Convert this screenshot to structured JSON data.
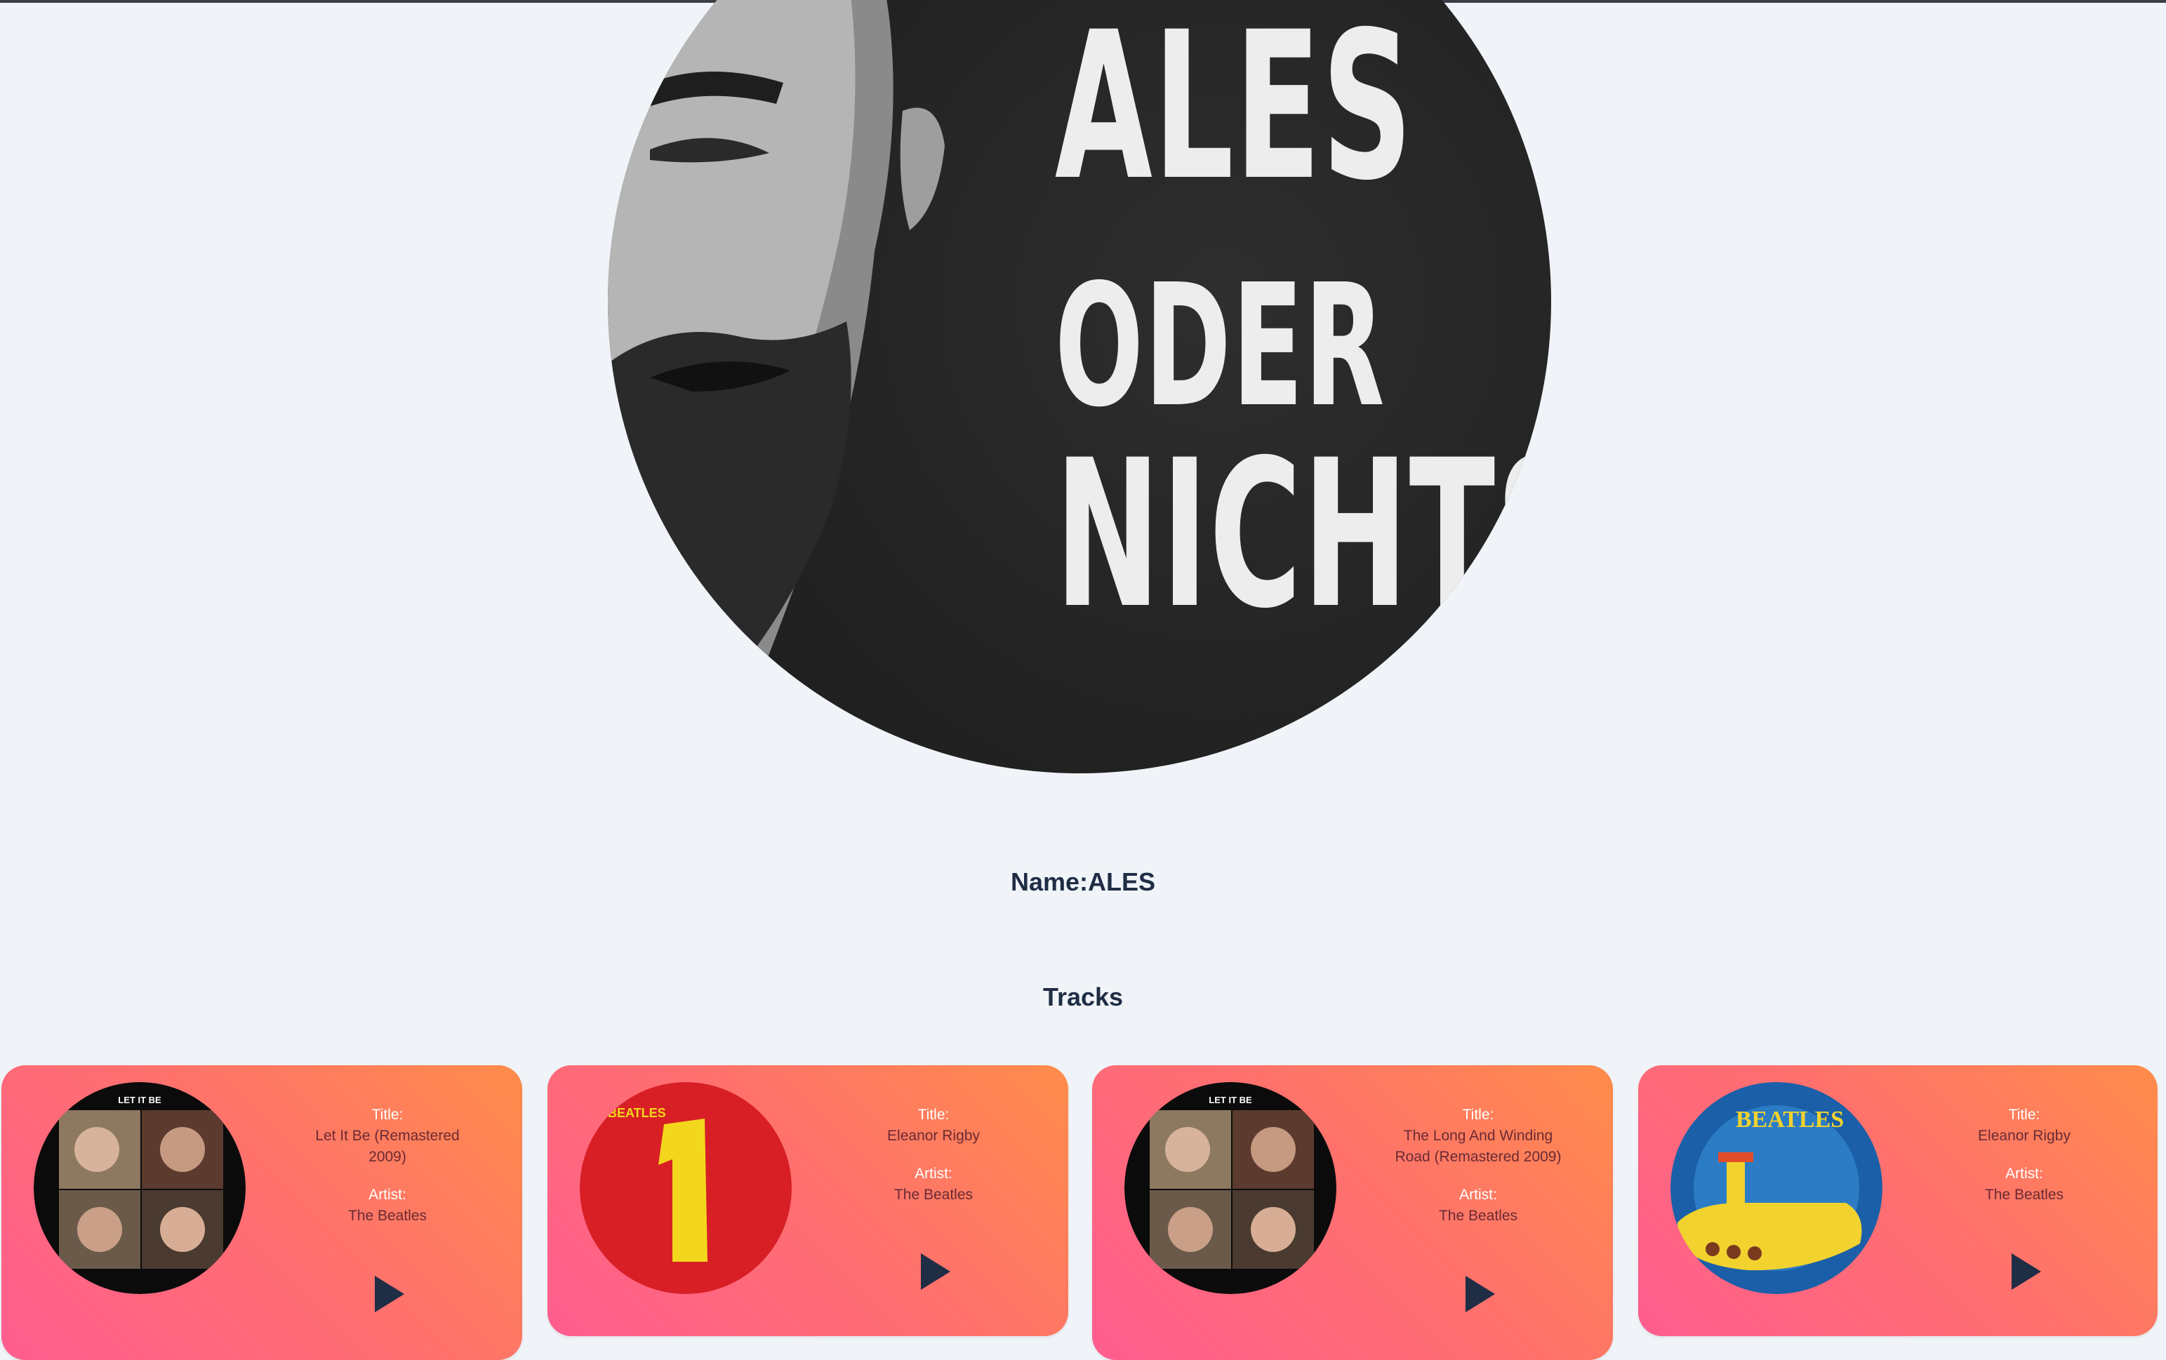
{
  "profile": {
    "avatar_text": [
      "ALES",
      "ODER",
      "NICHTS"
    ],
    "name_label": "Name:ALES"
  },
  "tracks_heading": "Tracks",
  "tracks": [
    {
      "title_label": "Title:",
      "title": "Let It Be (Remastered 2009)",
      "artist_label": "Artist:",
      "artist": "The Beatles",
      "cover_icon": "let-it-be-cover",
      "cover_text": "LET IT BE"
    },
    {
      "title_label": "Title:",
      "title": "Eleanor Rigby",
      "artist_label": "Artist:",
      "artist": "The Beatles",
      "cover_icon": "beatles-1-cover",
      "cover_text": "BEATLES"
    },
    {
      "title_label": "Title:",
      "title": "The Long And Winding Road (Remastered 2009)",
      "artist_label": "Artist:",
      "artist": "The Beatles",
      "cover_icon": "let-it-be-cover",
      "cover_text": "LET IT BE"
    },
    {
      "title_label": "Title:",
      "title": "Eleanor Rigby",
      "artist_label": "Artist:",
      "artist": "The Beatles",
      "cover_icon": "yellow-submarine-cover",
      "cover_text": "BEATLES"
    }
  ],
  "colors": {
    "page_bg": "#f0f4f8",
    "heading": "#1f2d45",
    "card_gradient": [
      "#ff5d8f",
      "#ff8c4a"
    ],
    "play_icon": "#1f2d45"
  }
}
